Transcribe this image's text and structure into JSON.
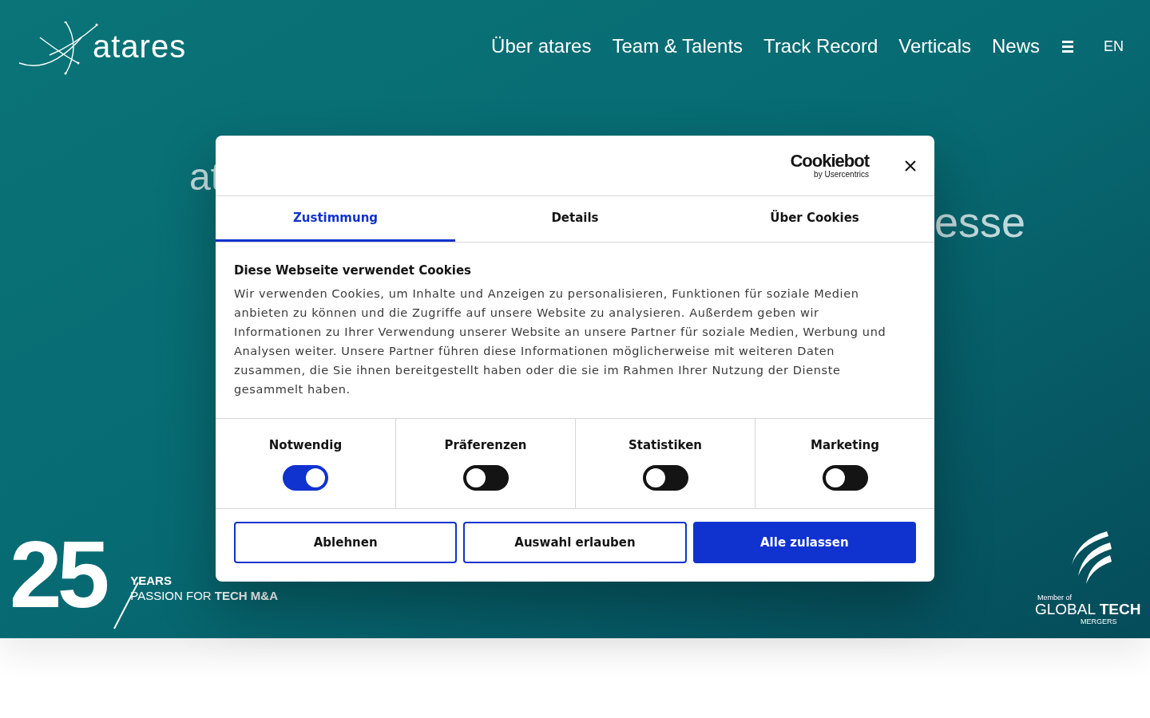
{
  "header": {
    "logo": "atares",
    "nav": [
      {
        "label": "Über atares"
      },
      {
        "label": "Team & Talents"
      },
      {
        "label": "Track Record"
      },
      {
        "label": "Verticals"
      },
      {
        "label": "News"
      }
    ],
    "language": "EN"
  },
  "hero": {
    "fragments": [
      "at",
      "esse"
    ],
    "anniversary": {
      "number": "25",
      "years": "YEARS",
      "tagline": "PASSION FOR **TECH M&A**"
    },
    "membership": {
      "prefix": "Member of",
      "name": "GLOBAL **TECH**",
      "suffix": "MERGERS"
    }
  },
  "cookie_dialog": {
    "brand": {
      "name": "Cookiebot",
      "byline": "by Usercentrics"
    },
    "tabs": [
      {
        "label": "Zustimmung",
        "selected": true
      },
      {
        "label": "Details",
        "selected": false
      },
      {
        "label": "Über Cookies",
        "selected": false
      }
    ],
    "title": "Diese Webseite verwendet Cookies",
    "text": "Wir verwenden Cookies, um Inhalte und Anzeigen zu personalisieren, Funktionen für soziale Medien anbieten zu können und die Zugriffe auf unsere Website zu analysieren. Außerdem geben wir Informationen zu Ihrer Verwendung unserer Website an unsere Partner für soziale Medien, Werbung und Analysen weiter. Unsere Partner führen diese Informationen möglicherweise mit weiteren Daten zusammen, die Sie ihnen bereitgestellt haben oder die sie im Rahmen Ihrer Nutzung der Dienste gesammelt haben.",
    "categories": [
      {
        "label": "Notwendig",
        "checked": true
      },
      {
        "label": "Präferenzen",
        "checked": false
      },
      {
        "label": "Statistiken",
        "checked": false
      },
      {
        "label": "Marketing",
        "checked": false
      }
    ],
    "buttons": [
      {
        "label": "Ablehnen",
        "kind": "outline"
      },
      {
        "label": "Auswahl erlauben",
        "kind": "outline"
      },
      {
        "label": "Alle zulassen",
        "kind": "primary"
      }
    ]
  }
}
